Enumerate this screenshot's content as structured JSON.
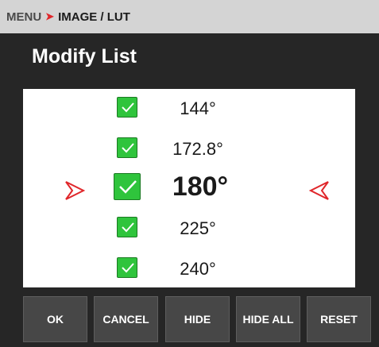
{
  "breadcrumb": {
    "menu": "MENU",
    "separator": "➤",
    "path": "IMAGE / LUT"
  },
  "title": "Modify List",
  "list": [
    {
      "value": "144°",
      "checked": true,
      "selected": false
    },
    {
      "value": "172.8°",
      "checked": true,
      "selected": false
    },
    {
      "value": "180°",
      "checked": true,
      "selected": true
    },
    {
      "value": "225°",
      "checked": true,
      "selected": false
    },
    {
      "value": "240°",
      "checked": true,
      "selected": false
    }
  ],
  "buttons": {
    "ok": "OK",
    "cancel": "CANCEL",
    "hide": "HIDE",
    "hide_all": "HIDE ALL",
    "reset": "RESET"
  },
  "icons": {
    "checkbox": "check-icon",
    "left_arrow": "arrow-right-icon",
    "right_arrow": "arrow-left-icon"
  },
  "colors": {
    "accent": "#e0262a",
    "checkbox": "#2fc43c",
    "background": "#262626",
    "button": "#474747",
    "breadcrumb": "#d4d4d4"
  }
}
